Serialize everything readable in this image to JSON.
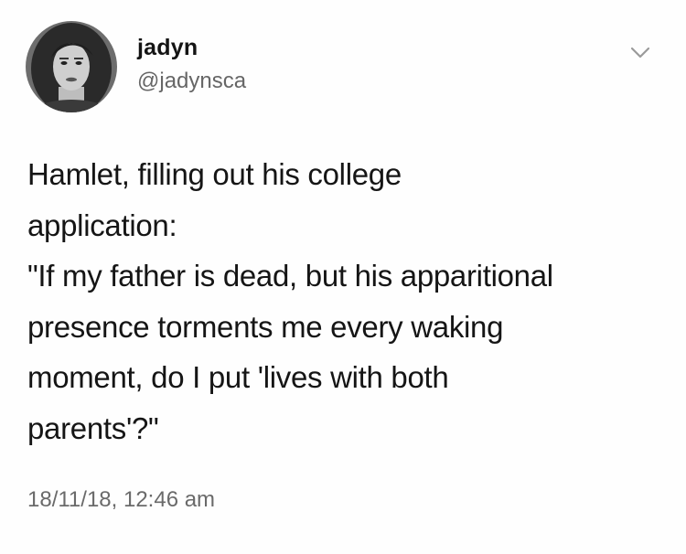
{
  "tweet": {
    "display_name": "jadyn",
    "handle": "@jadynsca",
    "text": "Hamlet, filling out his college\napplication:\n\"If my father is dead, but his apparitional\npresence torments me every waking\nmoment, do I put 'lives with both\nparents'?\"",
    "timestamp": "18/11/18, 12:46 am",
    "menu_icon": "chevron-down-icon",
    "avatar_icon": "profile-photo"
  },
  "colors": {
    "background": "#ffffff",
    "text": "#151515",
    "secondary_text": "#666666"
  }
}
